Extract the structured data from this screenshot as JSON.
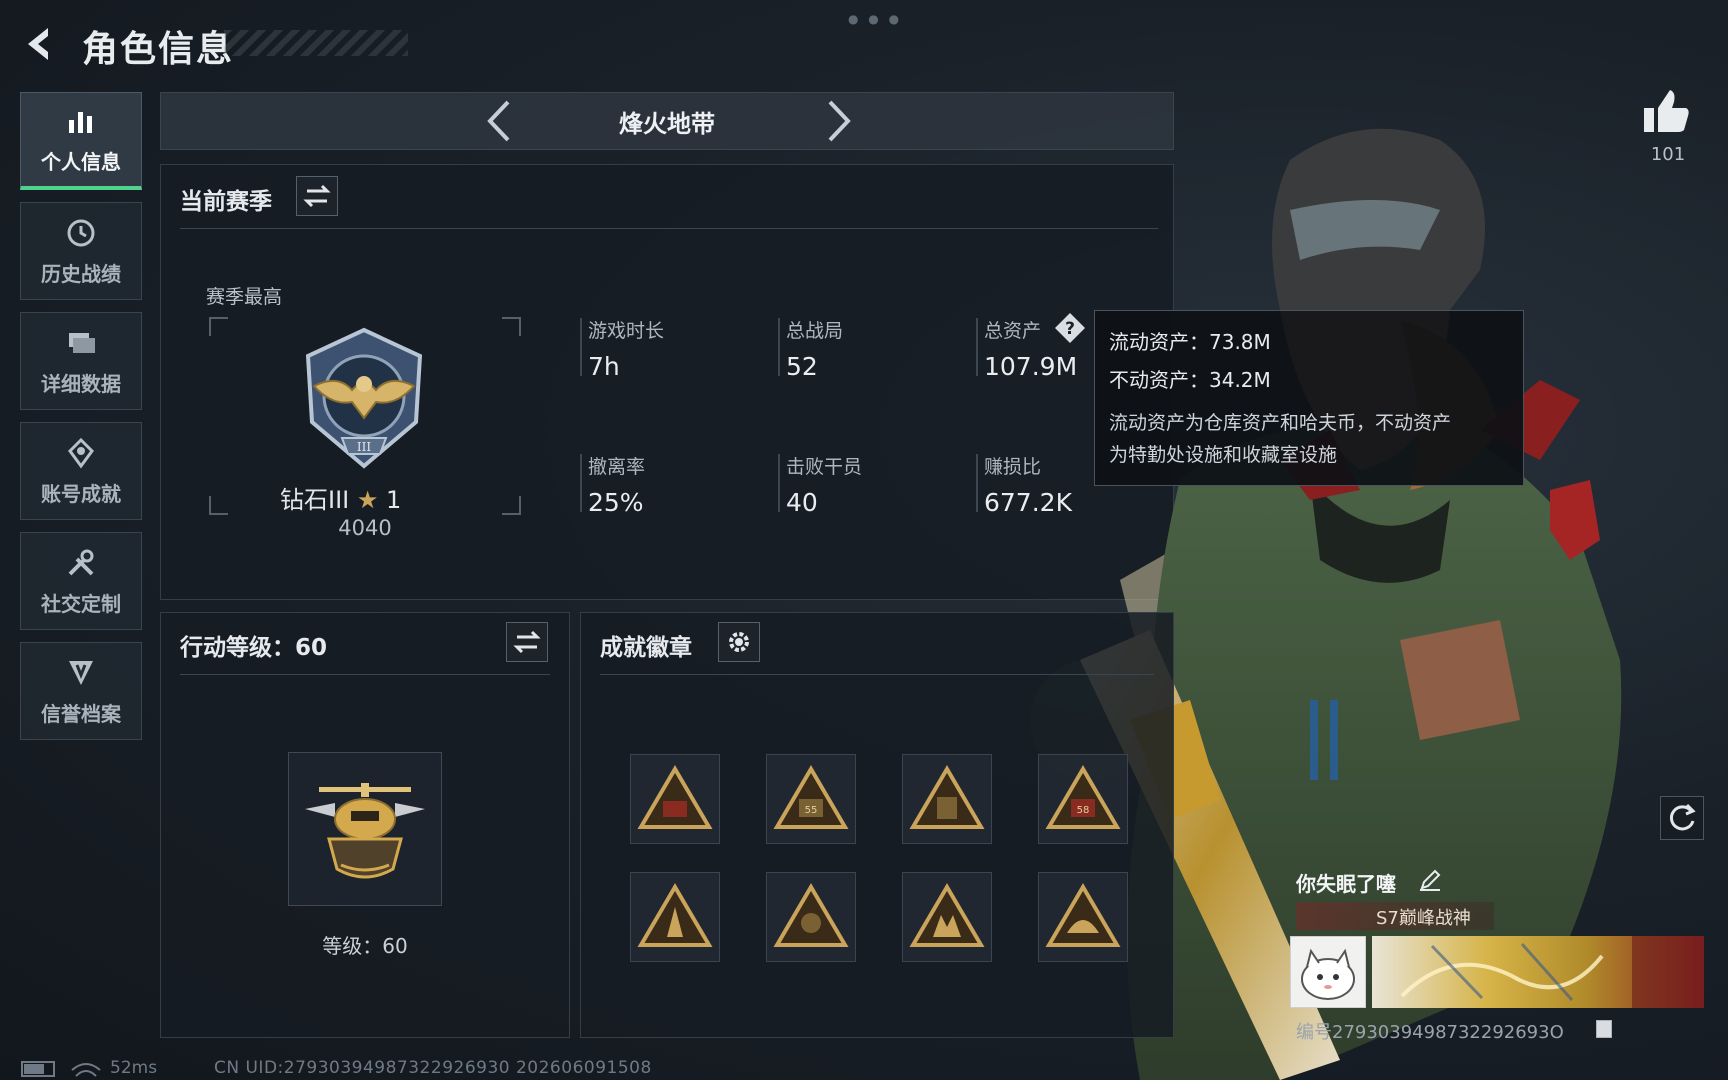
{
  "header": {
    "title": "角色信息"
  },
  "sidebar": {
    "items": [
      {
        "label": "个人信息",
        "icon": "bar-chart-icon",
        "active": true
      },
      {
        "label": "历史战绩",
        "icon": "history-icon",
        "active": false
      },
      {
        "label": "详细数据",
        "icon": "folder-icon",
        "active": false
      },
      {
        "label": "账号成就",
        "icon": "achievement-icon",
        "active": false
      },
      {
        "label": "社交定制",
        "icon": "tools-icon",
        "active": false
      },
      {
        "label": "信誉档案",
        "icon": "shield-icon",
        "active": false
      }
    ]
  },
  "mode": {
    "title": "烽火地带"
  },
  "season": {
    "title": "当前赛季",
    "best_label": "赛季最高",
    "rank_name": "钻石III",
    "rank_star": "1",
    "rank_score": "4040",
    "stats": [
      {
        "label": "游戏时长",
        "value": "7h"
      },
      {
        "label": "总战局",
        "value": "52"
      },
      {
        "label": "总资产",
        "value": "107.9M"
      },
      {
        "label": "撤离率",
        "value": "25%"
      },
      {
        "label": "击败干员",
        "value": "40"
      },
      {
        "label": "赚损比",
        "value": "677.2K"
      }
    ]
  },
  "tooltip": {
    "line1": "流动资产：73.8M",
    "line2": "不动资产：34.2M",
    "line3": "流动资产为仓库资产和哈夫币，不动资产",
    "line4": "为特勤处设施和收藏室设施"
  },
  "level": {
    "title": "行动等级：60",
    "text": "等级：60"
  },
  "achievements": {
    "title": "成就徽章",
    "badges": [
      "badge-1",
      "badge-2",
      "badge-3",
      "badge-4",
      "badge-5",
      "badge-6",
      "badge-7",
      "badge-8"
    ],
    "badge_numbers": [
      "",
      "55",
      "",
      "58",
      "",
      "",
      "",
      ""
    ]
  },
  "like": {
    "count": "101"
  },
  "player": {
    "name": "你失眠了噻",
    "title": "S7巅峰战神",
    "card_id": "编号2793039498732292693O"
  },
  "status": {
    "ping": "52ms",
    "uid": "CN UID:27930394987322926930 202606091508"
  },
  "colors": {
    "accent": "#4fd38c",
    "gold": "#c9a45a"
  }
}
